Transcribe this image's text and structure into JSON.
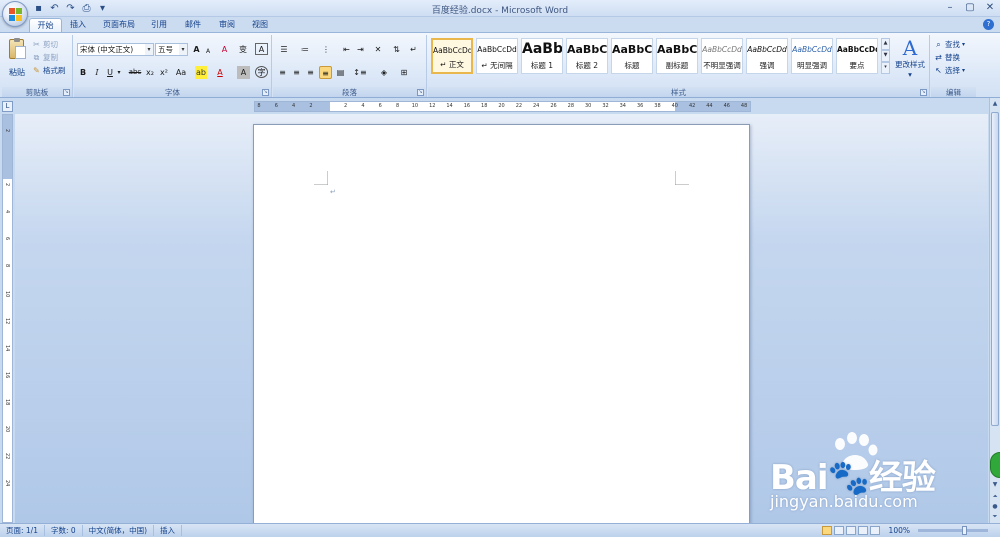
{
  "window": {
    "title": "百度经验.docx - Microsoft Word"
  },
  "tabs": [
    {
      "label": "开始",
      "active": true
    },
    {
      "label": "插入"
    },
    {
      "label": "页面布局"
    },
    {
      "label": "引用"
    },
    {
      "label": "邮件"
    },
    {
      "label": "审阅"
    },
    {
      "label": "视图"
    }
  ],
  "ribbon": {
    "clipboard": {
      "group_label": "剪贴板",
      "paste": "粘贴",
      "cut": "剪切",
      "copy": "复制",
      "format_painter": "格式刷"
    },
    "font": {
      "group_label": "字体",
      "font_name": "宋体 (中文正文)",
      "font_size": "五号",
      "bold": "B",
      "italic": "I",
      "underline": "U",
      "strike": "abc",
      "subscript": "x₂",
      "superscript": "x²",
      "change_case": "Aa",
      "font_color": "A",
      "char_border": "A",
      "grow": "A",
      "shrink": "A",
      "clear_format": "A",
      "phonetic": "变",
      "char_shading": "A"
    },
    "paragraph": {
      "group_label": "段落"
    },
    "styles": {
      "group_label": "样式",
      "items": [
        {
          "sample": "AaBbCcDd",
          "name": "↵ 正文",
          "active": true
        },
        {
          "sample": "AaBbCcDd",
          "name": "↵ 无间隔"
        },
        {
          "sample": "AaBb",
          "name": "标题 1"
        },
        {
          "sample": "AaBbC",
          "name": "标题 2"
        },
        {
          "sample": "AaBbC",
          "name": "标题"
        },
        {
          "sample": "AaBbC",
          "name": "副标题"
        },
        {
          "sample": "AaBbCcDd",
          "name": "不明显强调"
        },
        {
          "sample": "AaBbCcDd",
          "name": "强调"
        },
        {
          "sample": "AaBbCcDd",
          "name": "明显强调"
        },
        {
          "sample": "AaBbCcDd",
          "name": "要点"
        }
      ],
      "change_styles": "更改样式"
    },
    "editing": {
      "group_label": "编辑",
      "find": "查找",
      "replace": "替换",
      "select": "选择"
    }
  },
  "ruler": {
    "h_ticks": [
      "8",
      "6",
      "4",
      "2",
      "",
      "2",
      "4",
      "6",
      "8",
      "10",
      "12",
      "14",
      "16",
      "18",
      "20",
      "22",
      "24",
      "26",
      "28",
      "30",
      "32",
      "34",
      "36",
      "38",
      "40",
      "42",
      "44",
      "46",
      "48"
    ],
    "v_ticks": [
      "2",
      "",
      "2",
      "4",
      "6",
      "8",
      "10",
      "12",
      "14",
      "16",
      "18",
      "20",
      "22",
      "24"
    ]
  },
  "document": {
    "paragraph_mark": "↵"
  },
  "status": {
    "page": "页面: 1/1",
    "words": "字数: 0",
    "language": "中文(简体，中国)",
    "mode": "插入",
    "zoom": "100%"
  },
  "watermark": {
    "logo": "Bai🐾经验",
    "url": "jingyan.baidu.com"
  },
  "colors": {
    "accent": "#2e6ad0",
    "ribbon_text": "#15428b",
    "style_active_border": "#e9b74c"
  }
}
